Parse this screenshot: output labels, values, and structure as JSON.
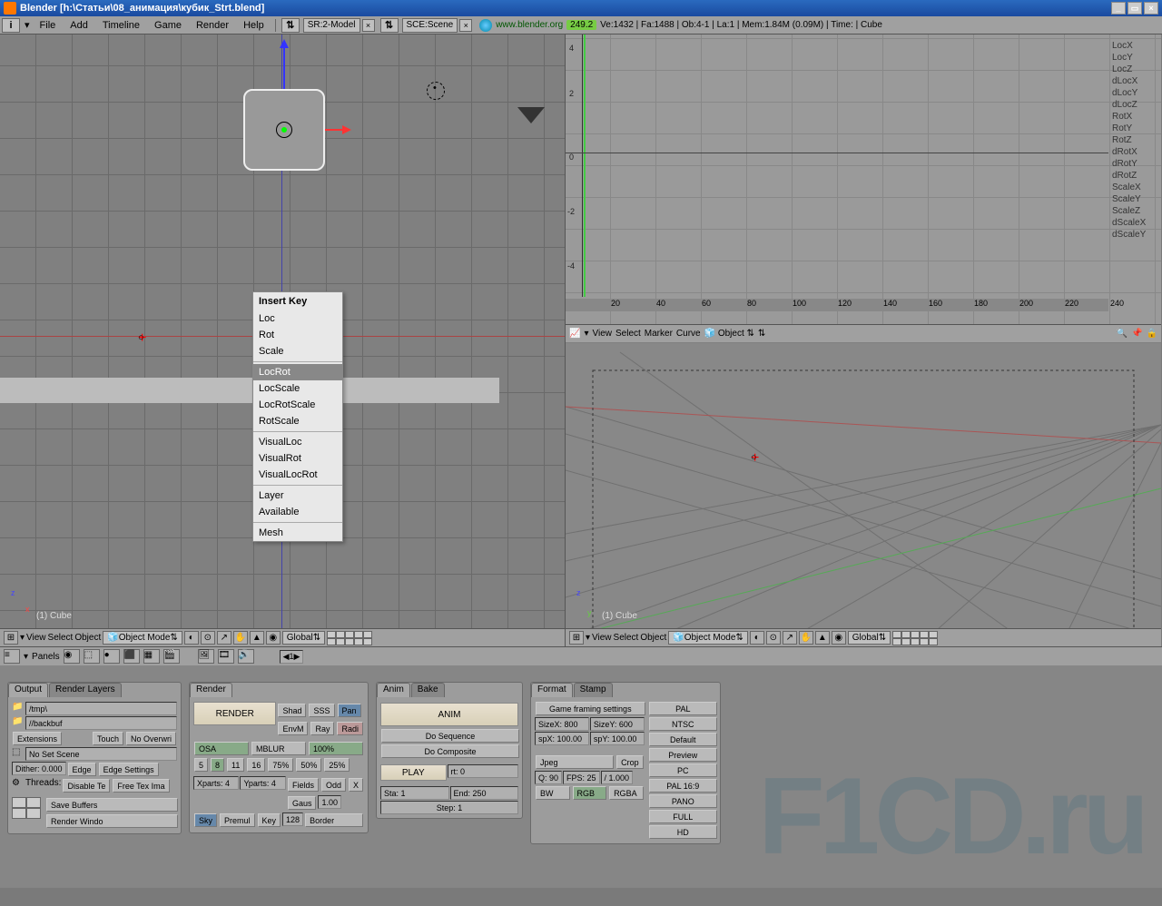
{
  "titlebar": {
    "title": "Blender [h:\\Статьи\\08_анимация\\кубик_Strt.blend]"
  },
  "menubar": {
    "items": [
      "File",
      "Add",
      "Timeline",
      "Game",
      "Render",
      "Help"
    ],
    "screen": "SR:2-Model",
    "scene": "SCE:Scene",
    "url": "www.blender.org",
    "version": "249.2",
    "stats": "Ve:1432 | Fa:1488 | Ob:4-1 | La:1  | Mem:1.84M (0.09M) | Time:  | Cube"
  },
  "ctx_menu": {
    "title": "Insert Key",
    "groups": [
      [
        "Loc",
        "Rot",
        "Scale"
      ],
      [
        "LocRot",
        "LocScale",
        "LocRotScale",
        "RotScale"
      ],
      [
        "VisualLoc",
        "VisualRot",
        "VisualLocRot"
      ],
      [
        "Layer",
        "Available"
      ],
      [
        "Mesh"
      ]
    ],
    "highlight": "LocRot"
  },
  "viewport_left": {
    "label": "(1) Cube"
  },
  "ipo": {
    "channels": [
      "LocX",
      "LocY",
      "LocZ",
      "dLocX",
      "dLocY",
      "dLocZ",
      "RotX",
      "RotY",
      "RotZ",
      "dRotX",
      "dRotY",
      "dRotZ",
      "ScaleX",
      "ScaleY",
      "ScaleZ",
      "dScaleX",
      "dScaleY"
    ],
    "ticks_y": [
      4,
      2,
      0,
      -2,
      -4
    ],
    "ticks_x": [
      20,
      40,
      60,
      80,
      100,
      120,
      140,
      160,
      180,
      200,
      220,
      240
    ],
    "header": {
      "view": "View",
      "select": "Select",
      "marker": "Marker",
      "curve": "Curve",
      "mode": "Object"
    }
  },
  "viewport_right": {
    "label": "(1) Cube"
  },
  "vp_header": {
    "items": [
      "View",
      "Select",
      "Object"
    ],
    "mode": "Object Mode",
    "global": "Global"
  },
  "panels_header": {
    "label": "Panels",
    "num": "1"
  },
  "panel_output": {
    "tabs": [
      "Output",
      "Render Layers"
    ],
    "tmp": "/tmp\\",
    "backbuf": "//backbuf",
    "ext": "Extensions",
    "touch": "Touch",
    "noover": "No Overwri",
    "noset": "No Set Scene",
    "dither": "Dither: 0.000",
    "edge": "Edge",
    "edgeset": "Edge Settings",
    "threads": "Threads:",
    "disable": "Disable Te",
    "freetex": "Free Tex Ima",
    "savebuf": "Save Buffers",
    "renderwin": "Render Windo"
  },
  "panel_render": {
    "tab": "Render",
    "render": "RENDER",
    "shad": "Shad",
    "sss": "SSS",
    "pan": "Pan",
    "envm": "EnvM",
    "ray": "Ray",
    "radi": "Radi",
    "osa": "OSA",
    "mblur": "MBLUR",
    "pct": "100%",
    "n5": "5",
    "n8": "8",
    "n11": "11",
    "n16": "16",
    "p75": "75%",
    "p50": "50%",
    "p25": "25%",
    "xparts": "Xparts: 4",
    "yparts": "Yparts: 4",
    "fields": "Fields",
    "odd": "Odd",
    "x": "X",
    "gaus": "Gaus",
    "gval": "1.00",
    "sky": "Sky",
    "premul": "Premul",
    "key": "Key",
    "k128": "128",
    "border": "Border"
  },
  "panel_anim": {
    "tabs": [
      "Anim",
      "Bake"
    ],
    "anim": "ANIM",
    "doseq": "Do Sequence",
    "docomp": "Do Composite",
    "play": "PLAY",
    "rt": "rt: 0",
    "sta": "Sta: 1",
    "end": "End: 250",
    "step": "Step: 1"
  },
  "panel_format": {
    "tabs": [
      "Format",
      "Stamp"
    ],
    "gfs": "Game framing settings",
    "sizex": "SizeX: 800",
    "sizey": "SizeY: 600",
    "aspx": "spX: 100.00",
    "aspy": "spY: 100.00",
    "jpeg": "Jpeg",
    "crop": "Crop",
    "q": "Q: 90",
    "fps": "FPS: 25",
    "fpsbase": "/ 1.000",
    "bw": "BW",
    "rgb": "RGB",
    "rgba": "RGBA",
    "presets": [
      "PAL",
      "NTSC",
      "Default",
      "Preview",
      "PC",
      "PAL 16:9",
      "PANO",
      "FULL",
      "HD"
    ]
  },
  "watermark": "F1CD.ru"
}
